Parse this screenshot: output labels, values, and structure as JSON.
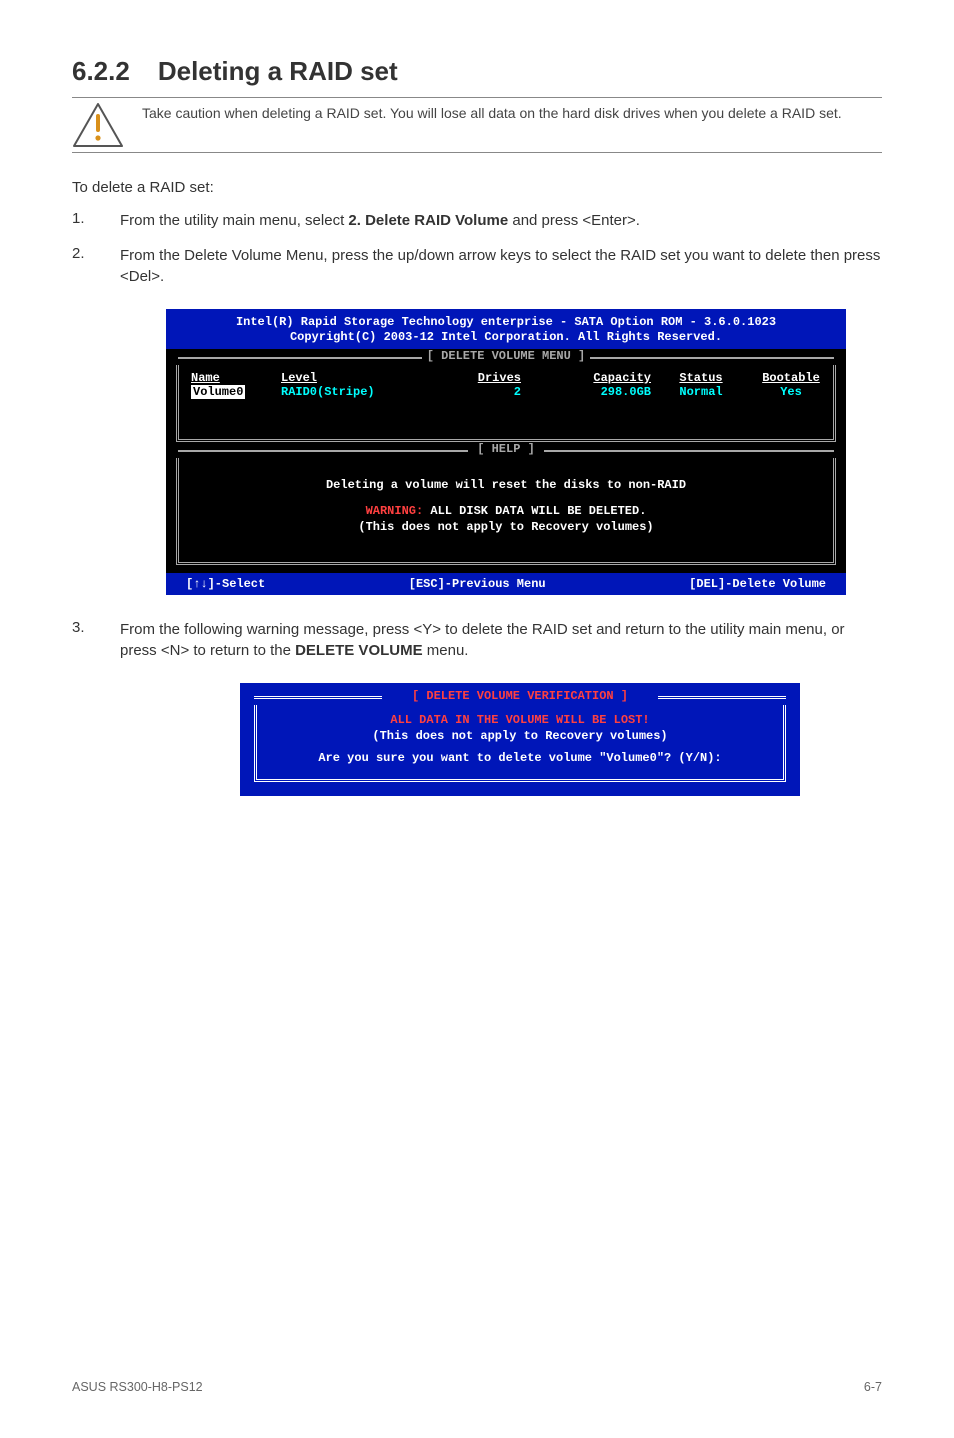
{
  "section": {
    "number": "6.2.2",
    "title": "Deleting a RAID set"
  },
  "callout": {
    "text": "Take caution when deleting a RAID set. You will lose all data on the hard disk drives when you delete a RAID set."
  },
  "intro": "To delete a RAID set:",
  "steps": {
    "s1": {
      "num": "1.",
      "pre": "From the utility main menu, select ",
      "bold": "2. Delete RAID Volume",
      "post": " and press <Enter>."
    },
    "s2": {
      "num": "2.",
      "text": "From the Delete Volume Menu, press the up/down arrow keys to select the RAID set you want to delete then press <Del>."
    },
    "s3": {
      "num": "3.",
      "pre": "From the following warning message, press <Y> to delete the RAID set and return to the utility main menu, or press <N> to return to the ",
      "bold": "DELETE VOLUME",
      "post": " menu."
    }
  },
  "bios": {
    "header": {
      "line1": "Intel(R) Rapid Storage Technology enterprise - SATA Option ROM - 3.6.0.1023",
      "line2": "Copyright(C) 2003-12 Intel Corporation.  All Rights Reserved."
    },
    "frame1_title": "[ DELETE VOLUME MENU ]",
    "columns": {
      "name": "Name",
      "level": "Level",
      "drives": "Drives",
      "capacity": "Capacity",
      "status": "Status",
      "bootable": "Bootable"
    },
    "row": {
      "name": "Volume0",
      "level": "RAID0(Stripe)",
      "drives": "2",
      "capacity": "298.0GB",
      "status": "Normal",
      "bootable": "Yes"
    },
    "frame2_title": "[ HELP ]",
    "help": {
      "l1": "Deleting a volume will reset the disks to non-RAID",
      "w_prefix": "WARNING:",
      "w_rest": " ALL DISK DATA WILL BE DELETED.",
      "l3": "(This does not apply to Recovery volumes)"
    },
    "footer": {
      "left": "[↑↓]-Select",
      "mid": "[ESC]-Previous Menu",
      "right": "[DEL]-Delete Volume"
    }
  },
  "dialog": {
    "title": "[ DELETE VOLUME VERIFICATION ]",
    "warn": "ALL DATA IN THE VOLUME WILL BE LOST!",
    "note": "(This does not apply to Recovery volumes)",
    "question": "Are you sure you want to delete volume \"Volume0\"? (Y/N):"
  },
  "footer": {
    "left": "ASUS RS300-H8-PS12",
    "right": "6-7"
  }
}
